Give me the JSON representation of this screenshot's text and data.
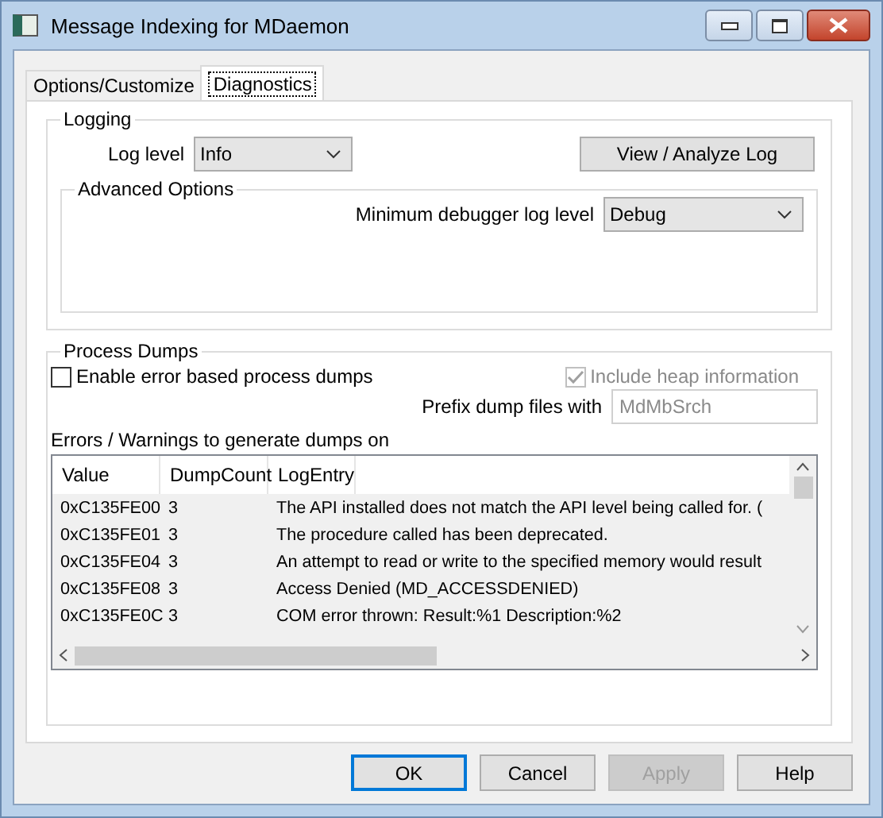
{
  "window": {
    "title": "Message Indexing for MDaemon"
  },
  "tabs": [
    {
      "label": "Options/Customize",
      "selected": false
    },
    {
      "label": "Diagnostics",
      "selected": true
    }
  ],
  "logging": {
    "title": "Logging",
    "log_level_label": "Log level",
    "log_level": "Info",
    "view_button": "View / Analyze Log",
    "advanced": {
      "title": "Advanced Options",
      "min_level_label": "Minimum debugger log level",
      "min_level": "Debug"
    }
  },
  "process_dumps": {
    "title": "Process Dumps",
    "enable": {
      "label": "Enable error based process dumps",
      "checked": false,
      "disabled": false
    },
    "include_heap": {
      "label": "Include heap information",
      "checked": true,
      "disabled": true
    },
    "prefix_label": "Prefix dump files with",
    "prefix_value": "MdMbSrch",
    "list_label": "Errors / Warnings to generate dumps on",
    "table": {
      "columns": [
        "Value",
        "DumpCount",
        "LogEntry"
      ],
      "rows": [
        [
          "0xC135FE00",
          "3",
          "The API installed does not match the API level being called for. ("
        ],
        [
          "0xC135FE01",
          "3",
          "The procedure called has been deprecated."
        ],
        [
          "0xC135FE04",
          "3",
          "An attempt to read or write to the specified memory would result"
        ],
        [
          "0xC135FE08",
          "3",
          "Access Denied (MD_ACCESSDENIED)"
        ],
        [
          "0xC135FE0C",
          "3",
          "COM error thrown: Result:%1 Description:%2"
        ]
      ]
    }
  },
  "buttons": [
    {
      "label": "OK",
      "kind": "default",
      "disabled": false
    },
    {
      "label": "Cancel",
      "kind": "normal",
      "disabled": false
    },
    {
      "label": "Apply",
      "kind": "normal",
      "disabled": true
    },
    {
      "label": "Help",
      "kind": "normal",
      "disabled": false
    }
  ]
}
